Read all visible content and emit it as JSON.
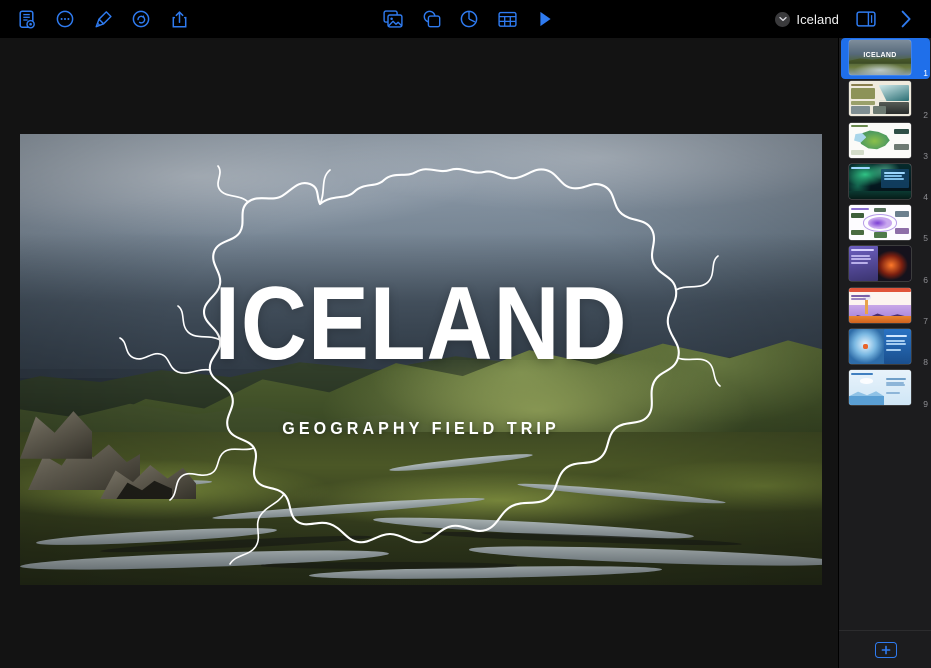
{
  "app": {
    "name": "Keynote",
    "document_title": "Iceland",
    "window_background": "#131313",
    "toolbar_background": "#000000",
    "accent_color": "#2f7bf0",
    "selection_color": "#1f6fea"
  },
  "toolbar": {
    "left_items": [
      {
        "name": "navigator-view-button",
        "icon": "document-navigator-icon",
        "label": "View"
      },
      {
        "name": "zoom-more-button",
        "icon": "ellipsis-circle-icon",
        "label": "More"
      },
      {
        "name": "format-paintbrush-button",
        "icon": "paintbrush-icon",
        "label": "Format"
      },
      {
        "name": "animate-button",
        "icon": "rotate-circle-icon",
        "label": "Animate"
      },
      {
        "name": "share-button",
        "icon": "share-up-arrow-icon",
        "label": "Share"
      }
    ],
    "center_items": [
      {
        "name": "insert-media-button",
        "icon": "media-photo-icon",
        "label": "Media"
      },
      {
        "name": "insert-shape-button",
        "icon": "shapes-icon",
        "label": "Shape"
      },
      {
        "name": "insert-chart-button",
        "icon": "pie-chart-icon",
        "label": "Chart"
      },
      {
        "name": "insert-table-button",
        "icon": "table-grid-icon",
        "label": "Table"
      },
      {
        "name": "play-button",
        "icon": "play-triangle-icon",
        "label": "Play"
      }
    ],
    "right_items": [
      {
        "name": "document-title-menu",
        "icon": "chevron-down-icon",
        "label": "Iceland"
      },
      {
        "name": "format-panel-toggle",
        "icon": "sidebar-panel-icon",
        "label": "Format"
      },
      {
        "name": "expand-panel-button",
        "icon": "chevron-right-icon",
        "label": "Show"
      }
    ]
  },
  "slide": {
    "title": "ICELAND",
    "subtitle": "GEOGRAPHY FIELD TRIP",
    "background_description": "Icelandic highland valley with braided glacial rivers, green mossy hills and low grey clouds",
    "overlay_description": "white outline map of Iceland"
  },
  "navigator": {
    "add_slide_label": "+",
    "slides": [
      {
        "number": "1",
        "selected": true,
        "theme": "title-photo",
        "title": "ICELAND"
      },
      {
        "number": "2",
        "selected": false,
        "theme": "cream-olive",
        "title": ""
      },
      {
        "number": "3",
        "selected": false,
        "theme": "white-map",
        "title": ""
      },
      {
        "number": "4",
        "selected": false,
        "theme": "aurora-green",
        "title": ""
      },
      {
        "number": "5",
        "selected": false,
        "theme": "purple-diagram",
        "title": ""
      },
      {
        "number": "6",
        "selected": false,
        "theme": "volcano-dark",
        "title": ""
      },
      {
        "number": "7",
        "selected": false,
        "theme": "geyser-illus",
        "title": ""
      },
      {
        "number": "8",
        "selected": false,
        "theme": "glacier-blue",
        "title": ""
      },
      {
        "number": "9",
        "selected": false,
        "theme": "iceberg-light",
        "title": ""
      }
    ]
  }
}
